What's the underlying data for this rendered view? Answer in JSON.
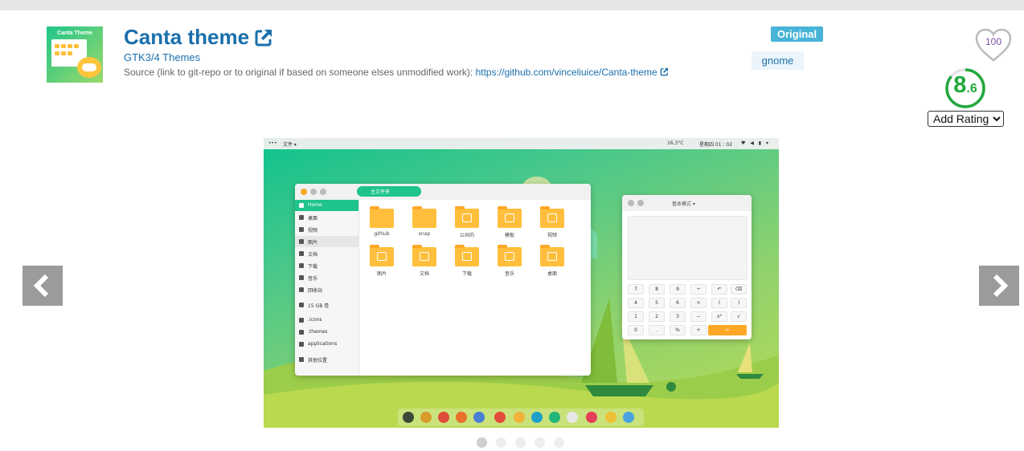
{
  "header": {
    "title": "Canta theme",
    "category": "GTK3/4 Themes",
    "source_label": "Source (link to git-repo or to original if based on someone elses unmodified work):",
    "source_url": "https://github.com/vinceliuice/Canta-theme",
    "thumbnail_text": "Canta Theme"
  },
  "badges": {
    "original": "Original",
    "tag": "gnome"
  },
  "rating": {
    "likes": "100",
    "score_int": "8",
    "score_dec": ".6",
    "add_rating": "Add Rating",
    "score_fraction": 0.86
  },
  "icons": [
    "external-link-icon",
    "heart-icon",
    "chevron-left-icon",
    "chevron-right-icon"
  ],
  "colors": {
    "link": "#1a6fad",
    "original_badge": "#48b4d7",
    "tag_bg": "#ecf5fb",
    "score": "#22a83c",
    "nav_arrow": "#9b9b9b"
  },
  "screenshot": {
    "panel": {
      "menu": "文件 ▾",
      "weather": "16.3°C",
      "clock": "星期四 01 : 02",
      "tray": "♥ ◀ ▮ ▾"
    },
    "file_manager": {
      "path": "主文件夹",
      "sidebar": [
        "Home",
        "桌面",
        "视频",
        "图片",
        "文档",
        "下载",
        "音乐",
        "回收站",
        "15 GB 卷",
        ".icons",
        ".themes",
        "applications",
        "其他位置"
      ],
      "folders": [
        "github",
        "snap",
        "公共的",
        "模板",
        "视频",
        "图片",
        "文档",
        "下载",
        "音乐",
        "桌面"
      ]
    },
    "calculator": {
      "mode": "基本模式 ▾",
      "keys": [
        "7",
        "8",
        "9",
        "÷",
        "↶",
        "⌫",
        "4",
        "5",
        "6",
        "×",
        "(",
        ")",
        "1",
        "2",
        "3",
        "−",
        "x²",
        "√",
        "0",
        ".",
        "%",
        "+",
        "="
      ]
    }
  },
  "carousel": {
    "slides": 5,
    "active": 0
  }
}
